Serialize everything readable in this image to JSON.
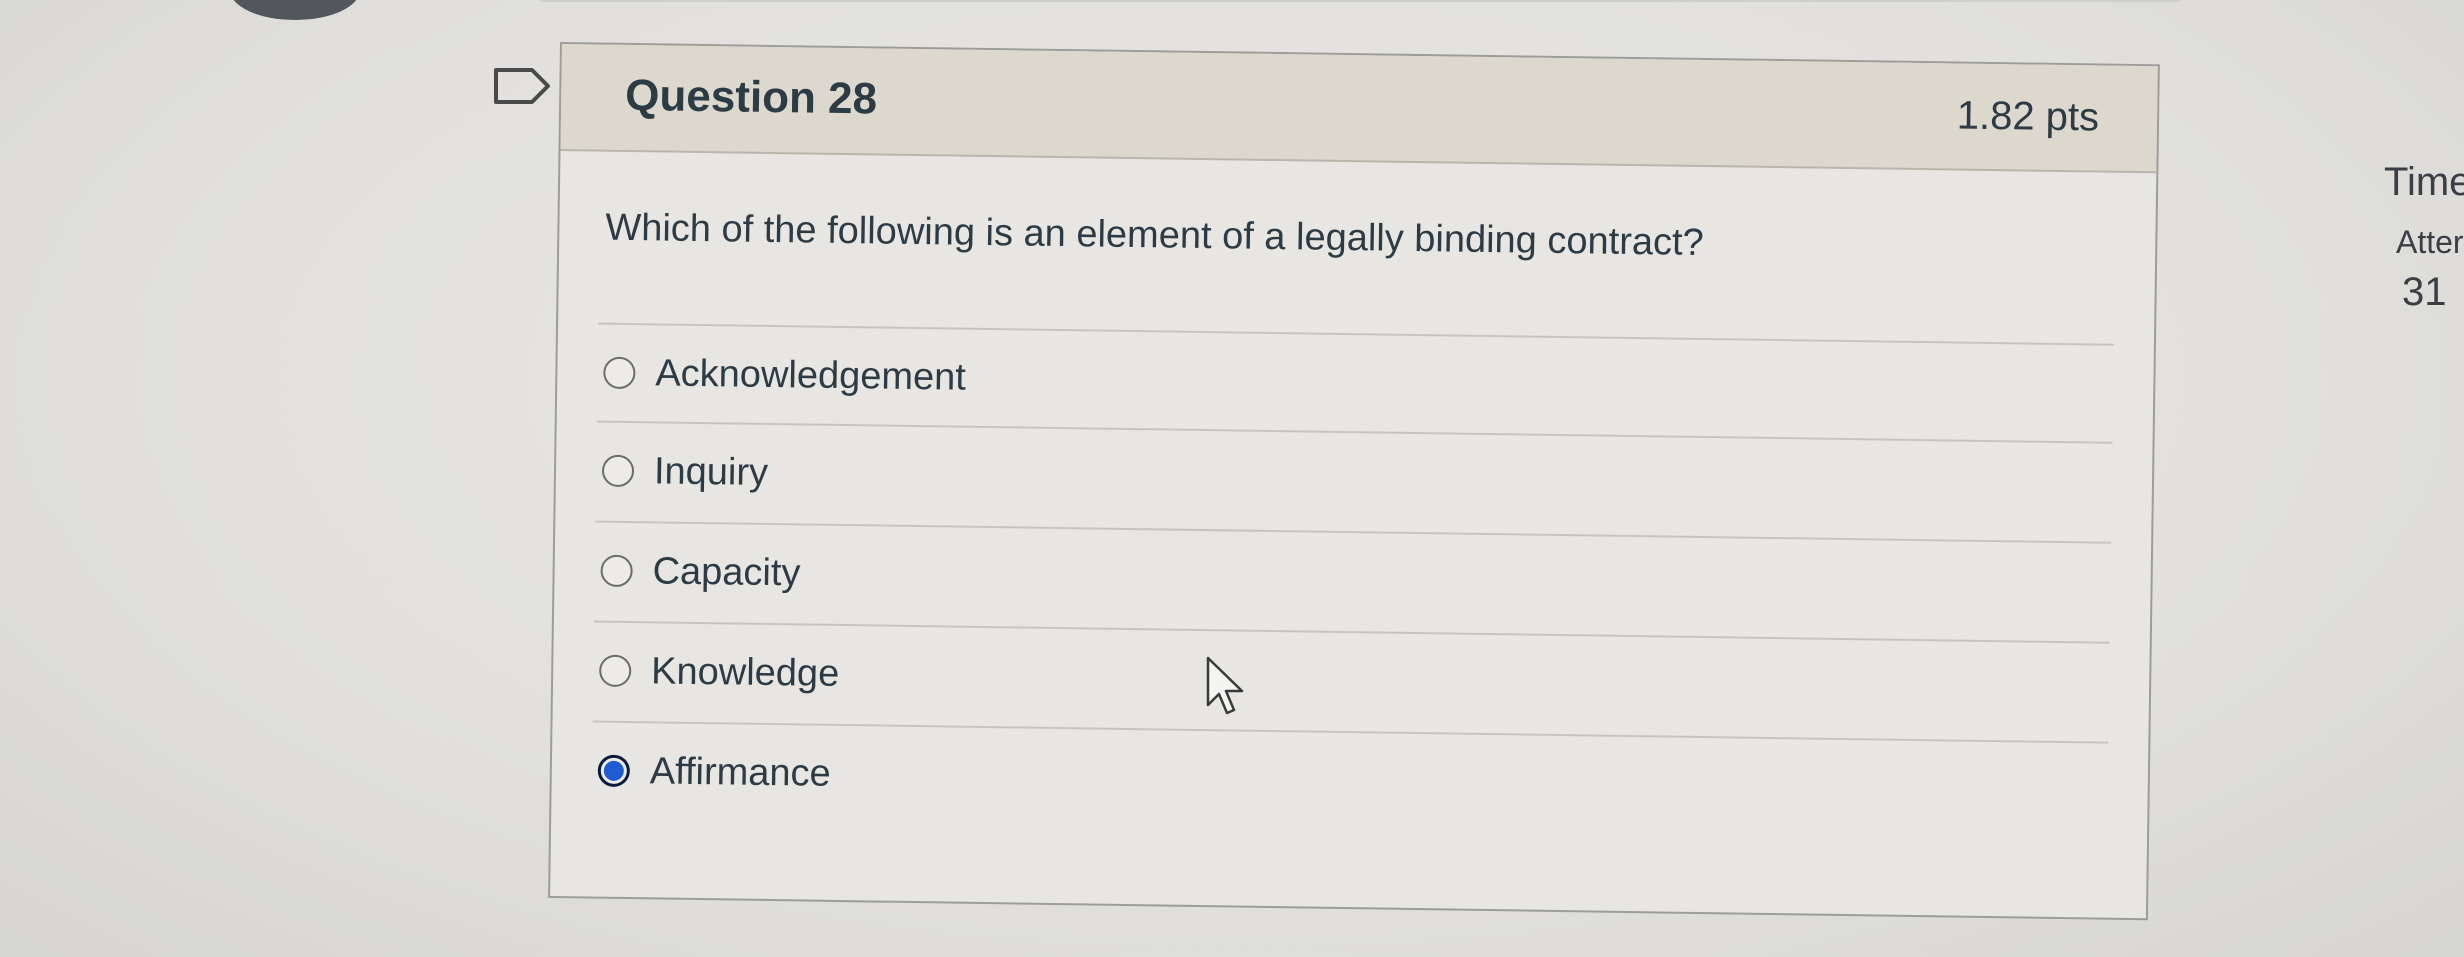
{
  "question": {
    "title": "Question 28",
    "points": "1.82 pts",
    "prompt": "Which of the following is an element of a legally binding contract?",
    "answers": [
      {
        "label": "Acknowledgement",
        "selected": false
      },
      {
        "label": "Inquiry",
        "selected": false
      },
      {
        "label": "Capacity",
        "selected": false
      },
      {
        "label": "Knowledge",
        "selected": false
      },
      {
        "label": "Affirmance",
        "selected": true
      }
    ]
  },
  "side_panel": {
    "time_label": "Time",
    "attempt_label": "Atter",
    "count": "31"
  },
  "colors": {
    "header_bg": "#dcd8cd",
    "card_bg": "#e7e6e3",
    "selected_radio": "#1f5cd1",
    "text": "#2d3b45"
  }
}
